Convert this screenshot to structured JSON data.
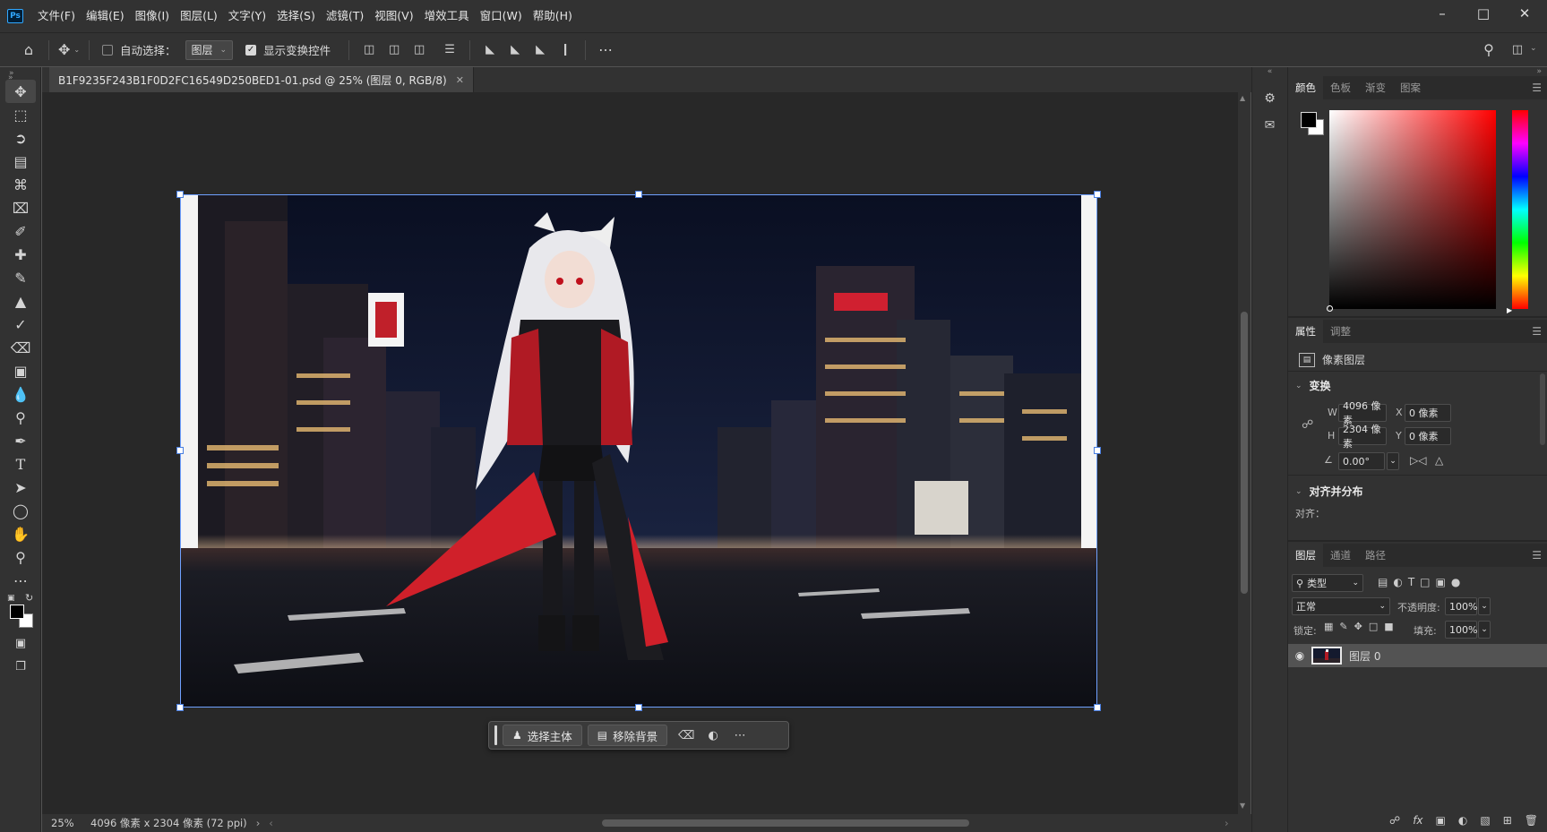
{
  "app": {
    "logo_text": "Ps",
    "menu": [
      "文件(F)",
      "编辑(E)",
      "图像(I)",
      "图层(L)",
      "文字(Y)",
      "选择(S)",
      "滤镜(T)",
      "视图(V)",
      "增效工具",
      "窗口(W)",
      "帮助(H)"
    ],
    "window_controls": [
      "minimize-icon",
      "maximize-icon",
      "close-icon"
    ]
  },
  "options_bar": {
    "auto_select_label": "自动选择：",
    "auto_select_checked": false,
    "auto_select_target": "图层",
    "show_transform_label": "显示变换控件",
    "show_transform_checked": true
  },
  "tools": [
    "move-tool",
    "marquee-tool",
    "lasso-tool",
    "object-select-tool",
    "crop-tool",
    "frame-tool",
    "eyedropper-tool",
    "healing-tool",
    "brush-tool",
    "stamp-tool",
    "history-brush-tool",
    "eraser-tool",
    "gradient-tool",
    "blur-tool",
    "dodge-tool",
    "pen-tool",
    "type-tool",
    "path-select-tool",
    "ellipse-tool",
    "hand-tool",
    "zoom-tool",
    "more-tools"
  ],
  "document": {
    "tab_title": "B1F9235F243B1F0D2FC16549D250BED1-01.psd @ 25% (图层 0, RGB/8)",
    "zoom": "25%",
    "doc_info": "4096 像素 x 2304 像素 (72 ppi)"
  },
  "contextual_taskbar": {
    "select_subject": "选择主体",
    "remove_background": "移除背景"
  },
  "color_panel": {
    "tabs": [
      "颜色",
      "色板",
      "渐变",
      "图案"
    ],
    "foreground": "#000000",
    "background": "#ffffff",
    "hue_color": "#ff0000"
  },
  "properties_panel": {
    "tabs": [
      "属性",
      "调整"
    ],
    "layer_kind": "像素图层",
    "transform_title": "变换",
    "w_label": "W",
    "w_value": "4096 像素",
    "h_label": "H",
    "h_value": "2304 像素",
    "x_label": "X",
    "x_value": "0 像素",
    "y_label": "Y",
    "y_value": "0 像素",
    "angle_value": "0.00°",
    "align_title": "对齐并分布",
    "align_label": "对齐："
  },
  "layers_panel": {
    "tabs": [
      "图层",
      "通道",
      "路径"
    ],
    "filter_label": "类型",
    "blend_mode": "正常",
    "opacity_label": "不透明度:",
    "opacity_value": "100%",
    "lock_label": "锁定:",
    "fill_label": "填充:",
    "fill_value": "100%",
    "layers": [
      {
        "name": "图层 0",
        "visible": true
      }
    ]
  }
}
